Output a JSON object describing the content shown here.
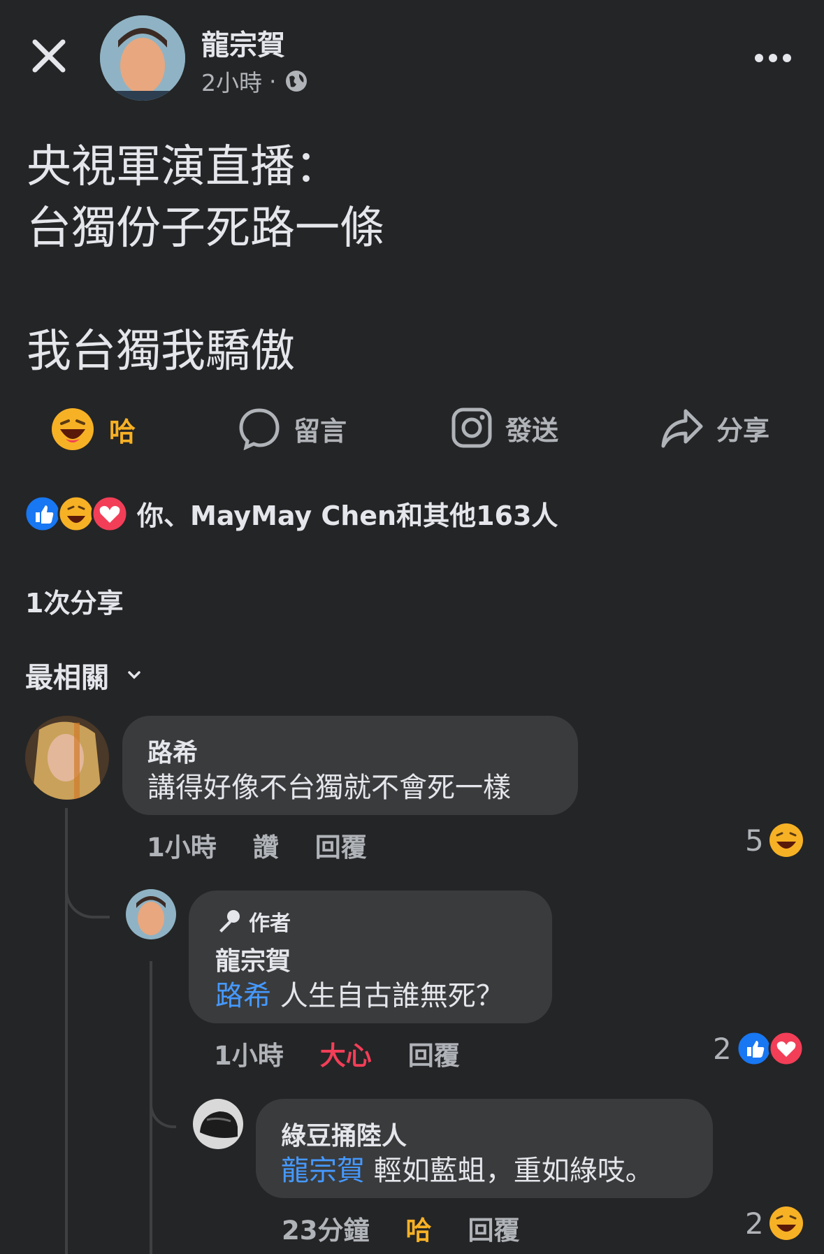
{
  "header": {
    "author": "龍宗賀",
    "time": "2小時",
    "separator": "·",
    "more_icon": "more-horizontal-icon",
    "close_icon": "close-icon",
    "audience_icon": "globe-icon"
  },
  "post": {
    "line1": "央視軍演直播：",
    "line2": "台獨份子死路一條",
    "line3": "我台獨我驕傲"
  },
  "actions": {
    "react": "哈",
    "comment": "留言",
    "send": "發送",
    "share": "分享"
  },
  "reactions_summary": "你、MayMay Chen和其他163人",
  "shares": "1次分享",
  "sort": "最相關",
  "comments": [
    {
      "name": "路希",
      "text": "講得好像不台獨就不會死一樣",
      "time": "1小時",
      "like": "讚",
      "reply": "回覆",
      "count": "5"
    },
    {
      "badge": "作者",
      "name": "龍宗賀",
      "mention": "路希",
      "text": " 人生自古誰無死？",
      "time": "1小時",
      "reacted": "大心",
      "reply": "回覆",
      "count": "2"
    },
    {
      "name": "綠豆捅陸人",
      "mention": "龍宗賀",
      "text": " 輕如藍蛆，重如綠吱。",
      "time": "23分鐘",
      "reacted": "哈",
      "reply": "回覆",
      "count": "2"
    }
  ],
  "colors": {
    "background": "#242526",
    "bubble": "#3a3b3c",
    "text": "#e4e6eb",
    "muted": "#b0b3b8",
    "mention": "#4599ff",
    "haha": "#f7b125",
    "love": "#f33e58",
    "like": "#1877f2"
  }
}
